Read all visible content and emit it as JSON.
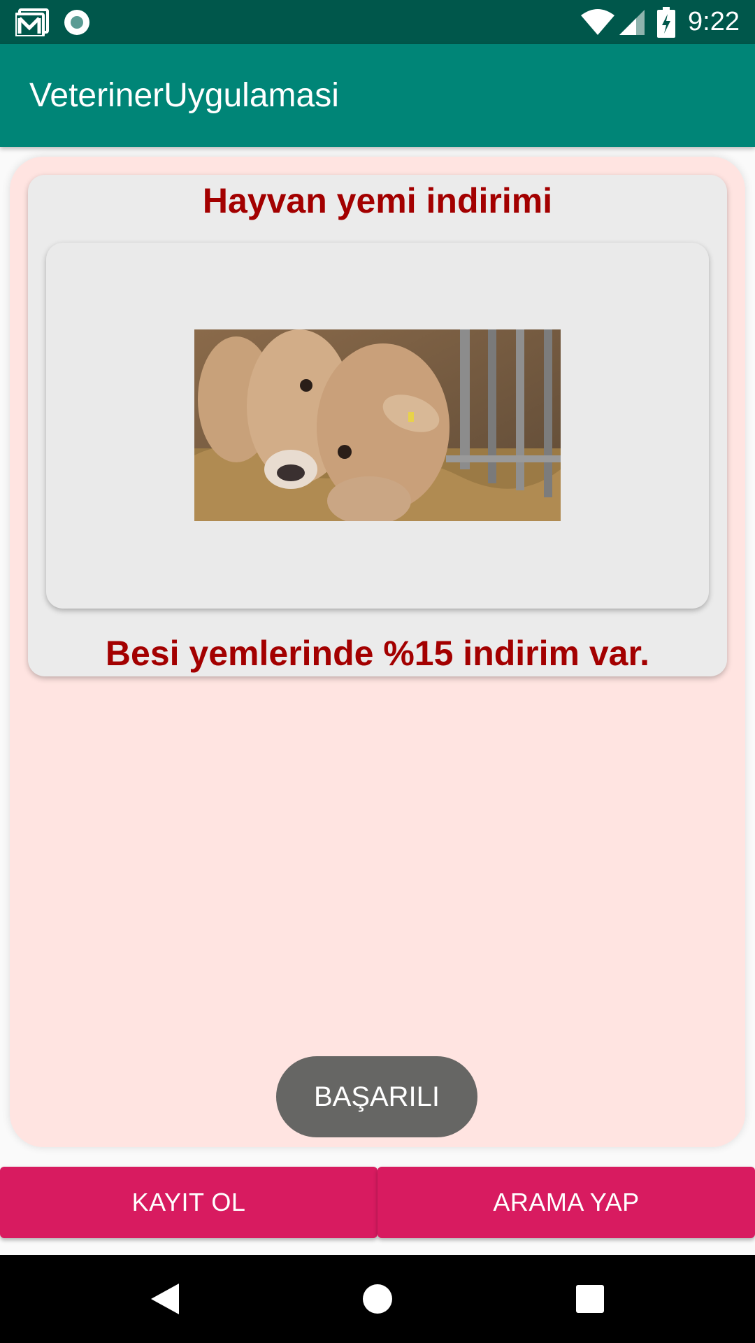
{
  "status_bar": {
    "time": "9:22",
    "icons": [
      "gmail-icon",
      "record-icon",
      "wifi-icon",
      "signal-icon",
      "battery-charging-icon"
    ]
  },
  "app_bar": {
    "title": "VeterinerUygulamasi"
  },
  "card": {
    "title": "Hayvan yemi indirimi",
    "image": "cows-eating-hay-photo",
    "text": "Besi yemlerinde %15 indirim var."
  },
  "toast": {
    "text": "BAŞARILI"
  },
  "buttons": {
    "register": "KAYIT OL",
    "search": "ARAMA YAP"
  },
  "nav_bar": {
    "icons": [
      "back-icon",
      "home-icon",
      "recents-icon"
    ]
  },
  "colors": {
    "status_bar": "#00574b",
    "app_bar": "#008577",
    "accent": "#d81b60",
    "panel": "#ffe4e1",
    "title_text": "#a30000"
  }
}
